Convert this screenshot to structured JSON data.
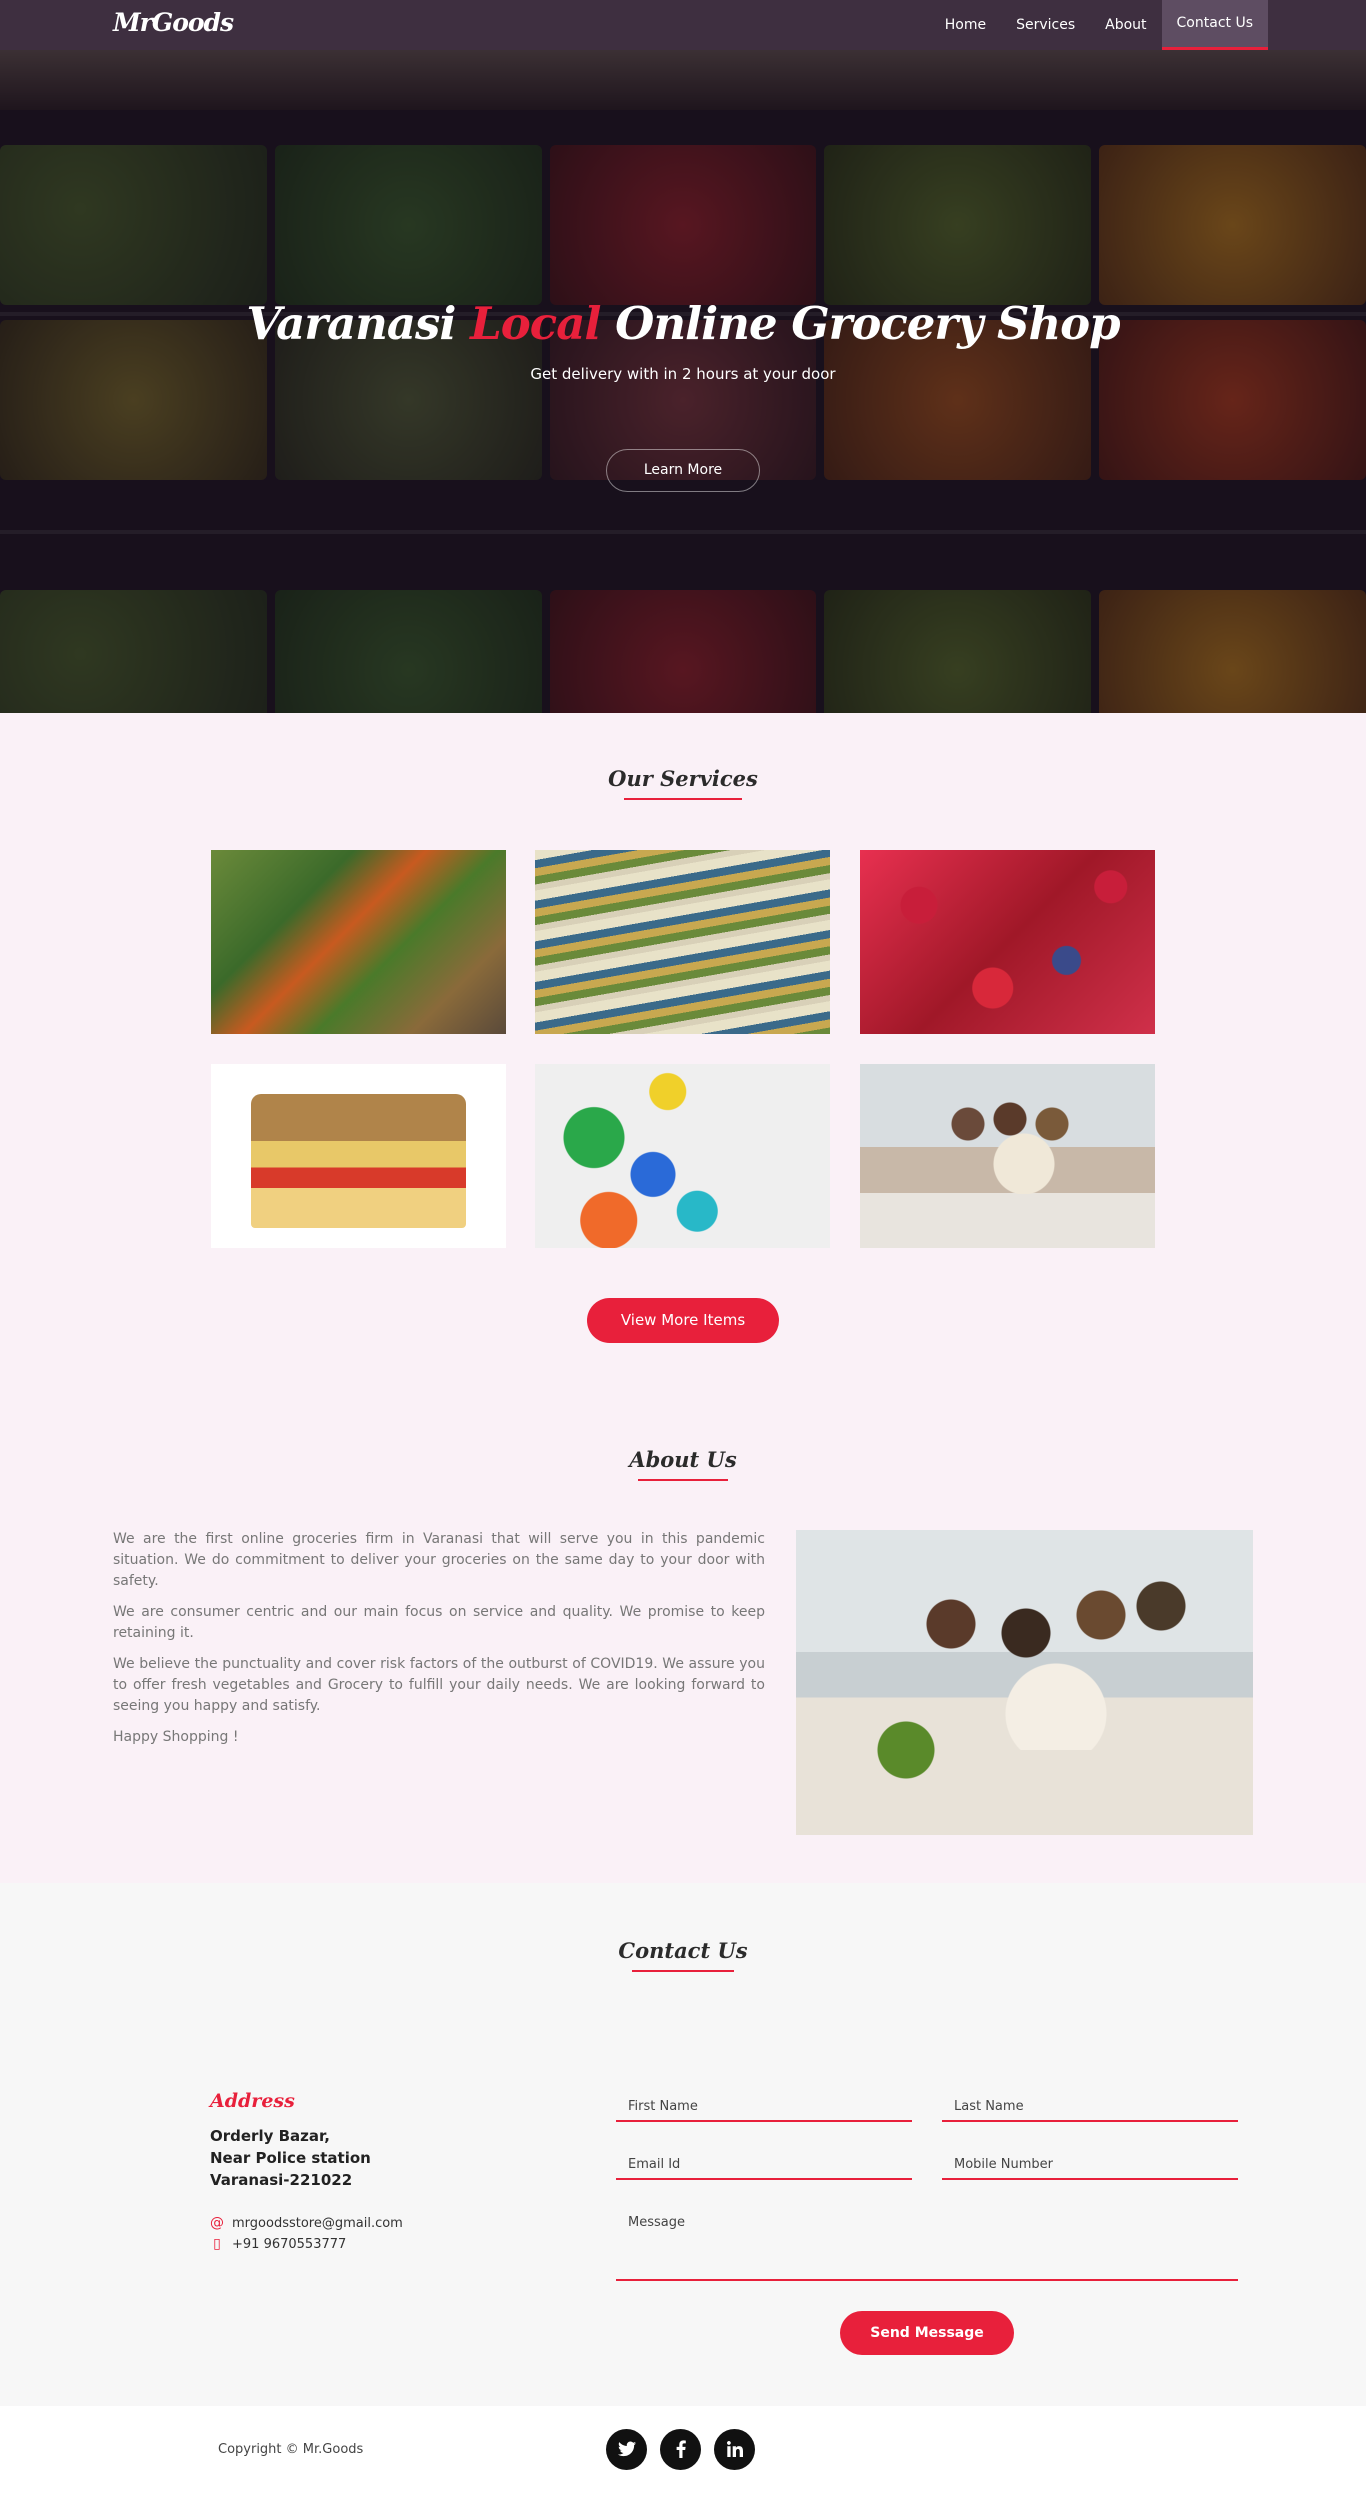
{
  "nav": {
    "brand": "MrGoods",
    "links": [
      "Home",
      "Services",
      "About",
      "Contact Us"
    ],
    "active": "Contact Us"
  },
  "hero": {
    "title_part1": "Varanasi",
    "title_accent": "Local",
    "title_part2": "Online Grocery Shop",
    "subtitle": "Get delivery with in 2 hours at your door",
    "button": "Learn More"
  },
  "services": {
    "title": "Our Services",
    "images": [
      "fresh-vegetables",
      "supermarket-aisle",
      "berries",
      "grains-and-packaged-goods",
      "cleaning-supplies",
      "team-at-work"
    ],
    "button": "View More Items"
  },
  "about": {
    "title": "About Us",
    "paragraphs": [
      "We are the first online groceries firm in Varanasi that will serve you in this pandemic situation. We do commitment to deliver your groceries on the same day to your door with safety.",
      "We are consumer centric and our main focus on service and quality. We promise to keep retaining it.",
      "We believe the punctuality and cover risk factors of the outburst of COVID19. We assure you to offer fresh vegetables and Grocery to fulfill your daily needs. We are looking forward to seeing you happy and satisfy.",
      "Happy Shopping !"
    ],
    "image": "team-meeting"
  },
  "contact": {
    "title": "Contact Us",
    "address_title": "Address",
    "address_lines": [
      "Orderly Bazar,",
      "Near Police station",
      "Varanasi-221022"
    ],
    "email": "mrgoodsstore@gmail.com",
    "phone": "+91 9670553777",
    "form": {
      "first_name": "First Name",
      "last_name": "Last Name",
      "email": "Email Id",
      "mobile": "Mobile Number",
      "message": "Message",
      "submit": "Send Message"
    }
  },
  "footer": {
    "copyright": "Copyright © Mr.Goods",
    "social": [
      "twitter",
      "facebook",
      "linkedin"
    ]
  },
  "colors": {
    "accent": "#e8203b",
    "nav": "#3e2f40",
    "section_bg": "#faf1f7"
  }
}
